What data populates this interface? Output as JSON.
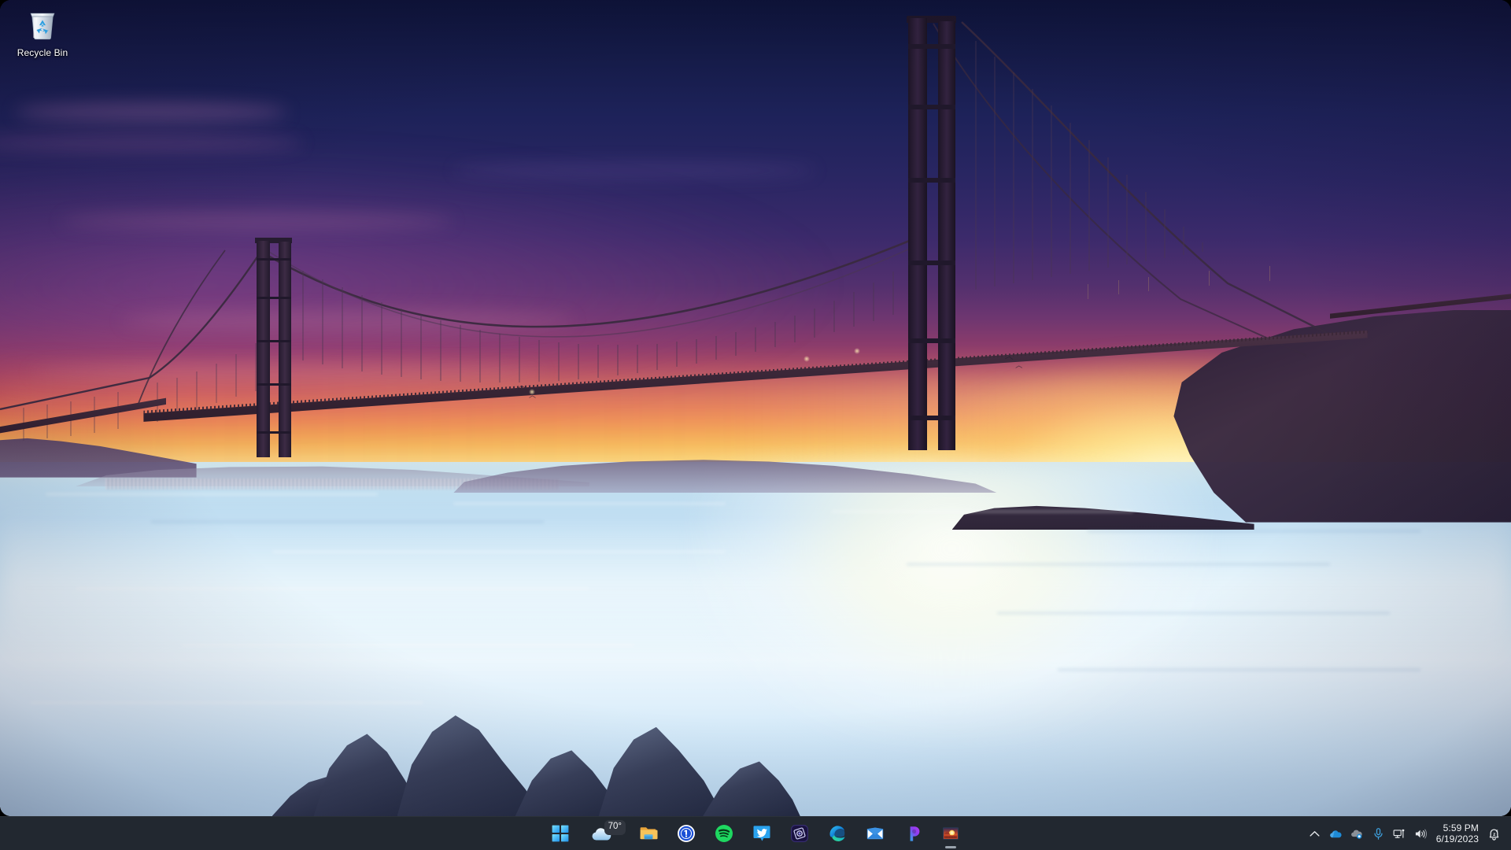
{
  "desktop": {
    "icons": [
      {
        "name": "recycle-bin",
        "label": "Recycle Bin",
        "icon": "recycle-bin-icon"
      }
    ],
    "wallpaper": {
      "scene": "Golden Gate Bridge at sunset",
      "sky_top_color": "#0d1338",
      "sky_mid_color": "#a8456a",
      "sun_glow_color": "#ffeb96",
      "water_color": "#cfe6f6",
      "bridge_silhouette_color": "#241a2b"
    }
  },
  "taskbar": {
    "background_color": "#222830",
    "buttons": [
      {
        "name": "start-button",
        "label": "Start",
        "icon": "windows-logo-icon",
        "active": false
      },
      {
        "name": "weather-widget",
        "label": "Weather",
        "icon": "cloud-icon",
        "temperature": "70°",
        "active": false
      },
      {
        "name": "file-explorer-button",
        "label": "File Explorer",
        "icon": "folder-icon",
        "active": false
      },
      {
        "name": "onepassword-button",
        "label": "1Password",
        "icon": "1password-icon",
        "active": false
      },
      {
        "name": "spotify-button",
        "label": "Spotify",
        "icon": "spotify-icon",
        "active": false
      },
      {
        "name": "twitter-button",
        "label": "Twitter",
        "icon": "twitter-bird-icon",
        "active": false
      },
      {
        "name": "app-button-7",
        "label": "Camo",
        "icon": "camo-icon",
        "active": false
      },
      {
        "name": "edge-button",
        "label": "Microsoft Edge",
        "icon": "edge-icon",
        "active": false
      },
      {
        "name": "mail-button",
        "label": "Mail",
        "icon": "mail-envelope-icon",
        "active": false
      },
      {
        "name": "app-button-10",
        "label": "Phone Link",
        "icon": "phone-link-icon",
        "active": false
      },
      {
        "name": "photos-button",
        "label": "Photos",
        "icon": "photos-icon",
        "active": true
      }
    ]
  },
  "tray": {
    "items": [
      {
        "name": "show-hidden-icons-button",
        "label": "Show hidden icons",
        "icon": "chevron-up-icon"
      },
      {
        "name": "onedrive-button",
        "label": "OneDrive",
        "icon": "cloud-filled-icon"
      },
      {
        "name": "onedrive-personal-button",
        "label": "OneDrive personal",
        "icon": "cloud-sync-icon"
      },
      {
        "name": "microphone-button",
        "label": "Microphone in use",
        "icon": "microphone-icon"
      },
      {
        "name": "network-button",
        "label": "Network",
        "icon": "network-monitor-icon"
      },
      {
        "name": "volume-button",
        "label": "Volume",
        "icon": "speaker-icon"
      }
    ],
    "clock": {
      "time": "5:59 PM",
      "date": "6/19/2023"
    },
    "notifications": {
      "name": "notification-center-button",
      "label": "Notifications",
      "icon": "bell-dnd-icon",
      "do_not_disturb": true
    }
  }
}
